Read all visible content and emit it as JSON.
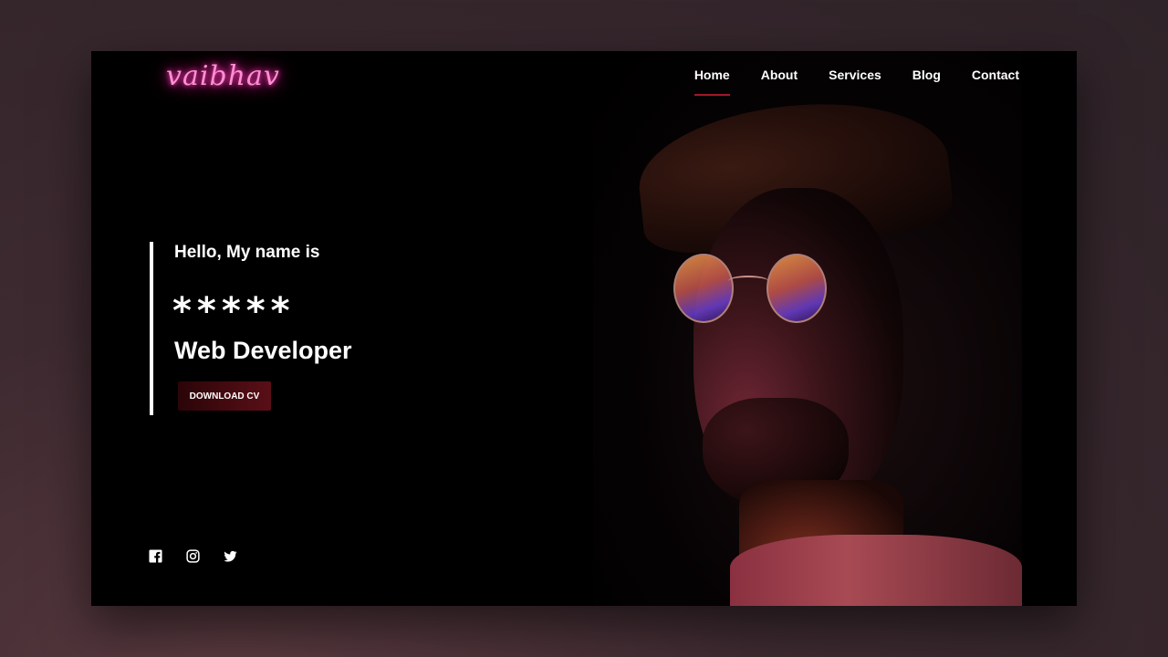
{
  "brand": {
    "logo_text": "vaibhav",
    "accent": "#ff3fb5"
  },
  "nav": {
    "items": [
      {
        "label": "Home",
        "active": true
      },
      {
        "label": "About",
        "active": false
      },
      {
        "label": "Services",
        "active": false
      },
      {
        "label": "Blog",
        "active": false
      },
      {
        "label": "Contact",
        "active": false
      }
    ],
    "active_underline_color": "#a01828"
  },
  "hero": {
    "greeting": "Hello, My name is",
    "name": "*****",
    "role": "Web Developer",
    "cta_label": "DOWNLOAD CV"
  },
  "socials": {
    "icons": [
      "facebook-icon",
      "instagram-icon",
      "twitter-icon"
    ]
  }
}
